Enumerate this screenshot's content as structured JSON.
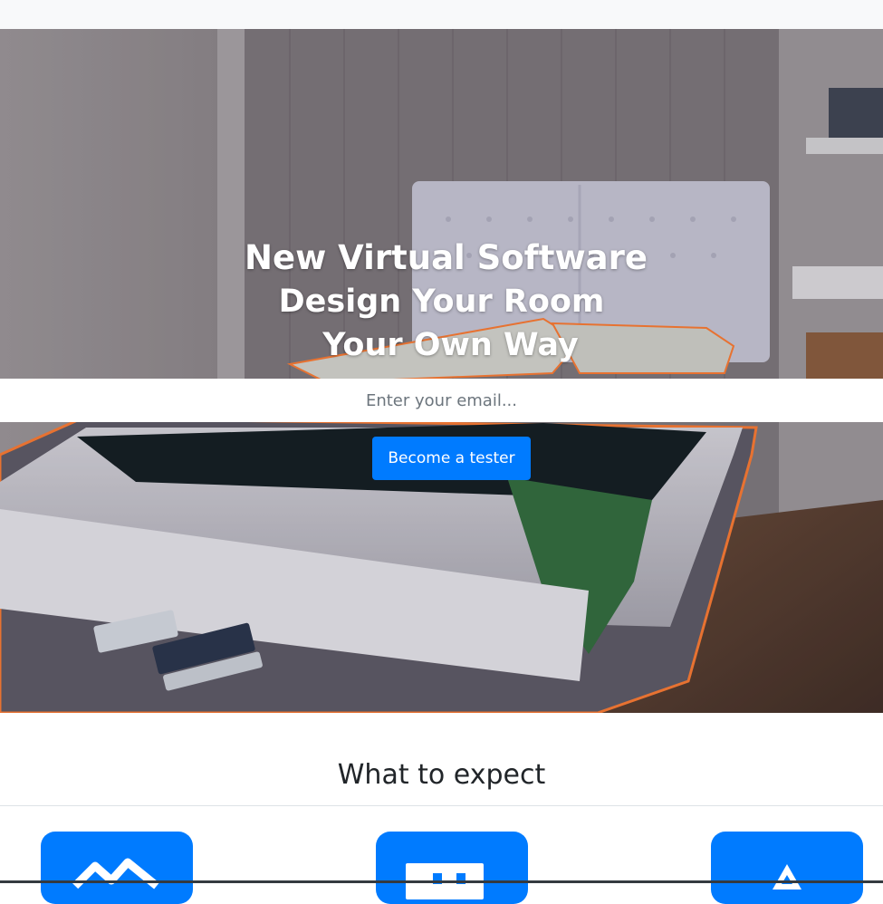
{
  "hero": {
    "title_line1": "New Virtual Software",
    "title_line2": "Design Your Room",
    "title_line3": "Your Own Way",
    "email_placeholder": "Enter your email...",
    "cta_label": "Become a tester"
  },
  "features": {
    "heading": "What to expect",
    "tiles": [
      {
        "icon": "landscape-icon"
      },
      {
        "icon": "layout-icon"
      },
      {
        "icon": "triangle-icon"
      }
    ]
  },
  "colors": {
    "primary": "#007bff",
    "topbar": "#f8f9fa",
    "heading_text": "#212529"
  }
}
